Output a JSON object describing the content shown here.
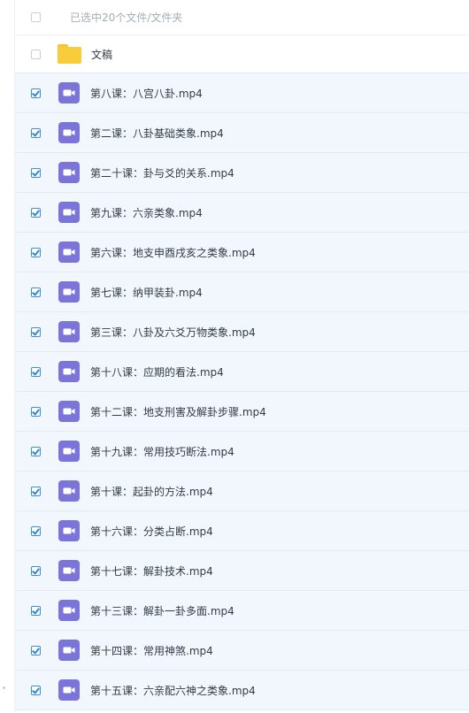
{
  "header": {
    "selected_summary": "已选中20个文件/文件夹"
  },
  "folder": {
    "name": "文稿"
  },
  "files": [
    {
      "name": "第八课：八宫八卦.mp4"
    },
    {
      "name": "第二课：八卦基础类象.mp4"
    },
    {
      "name": "第二十课：卦与爻的关系.mp4"
    },
    {
      "name": "第九课：六亲类象.mp4"
    },
    {
      "name": "第六课：地支申酉戌亥之类象.mp4"
    },
    {
      "name": "第七课：纳甲装卦.mp4"
    },
    {
      "name": "第三课：八卦及六爻万物类象.mp4"
    },
    {
      "name": "第十八课：应期的看法.mp4"
    },
    {
      "name": "第十二课：地支刑害及解卦步骤.mp4"
    },
    {
      "name": "第十九课：常用技巧断法.mp4"
    },
    {
      "name": "第十课：起卦的方法.mp4"
    },
    {
      "name": "第十六课：分类占断.mp4"
    },
    {
      "name": "第十七课：解卦技术.mp4"
    },
    {
      "name": "第十三课：解卦一卦多面.mp4"
    },
    {
      "name": "第十四课：常用神煞.mp4"
    },
    {
      "name": "第十五课：六亲配六神之类象.mp4"
    }
  ],
  "colors": {
    "accent": "#2f86d6",
    "video_icon": "#7b74d9",
    "folder_icon": "#f8cd3b",
    "selected_row": "#f1f7fc"
  },
  "icons": {
    "folder": "folder-icon",
    "video": "video-file-icon",
    "checkbox": "checkbox"
  }
}
